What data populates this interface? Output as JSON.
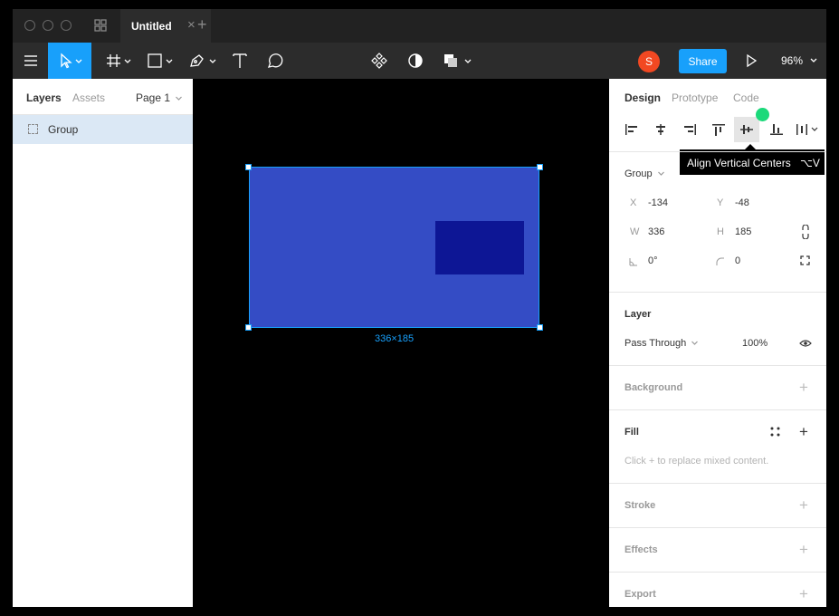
{
  "window": {
    "tab_title": "Untitled",
    "tab_close": "×",
    "tab_add": "+"
  },
  "toolbar": {
    "tools": [
      "menu-icon",
      "move-tool",
      "frame-tool",
      "shape-tool",
      "pen-tool",
      "text-tool",
      "comment-tool",
      "component-icon",
      "mask-icon",
      "boolean-icon"
    ],
    "avatar_initial": "S",
    "share_label": "Share",
    "zoom": "96%",
    "accent": "#18a0fb"
  },
  "left_panel": {
    "tab_layers": "Layers",
    "tab_assets": "Assets",
    "page": "Page 1",
    "layers": [
      {
        "name": "Group",
        "selected": true
      }
    ]
  },
  "canvas": {
    "size_label": "336×185",
    "colors": {
      "frame": "#344cc5",
      "inner": "#0d1695",
      "selection": "#18a0fb"
    }
  },
  "right_panel": {
    "tabs": [
      "Design",
      "Prototype",
      "Code"
    ],
    "tooltip": {
      "text": "Align Vertical Centers",
      "shortcut": "⌥V"
    },
    "group_label": "Group",
    "x_label": "X",
    "x": "-134",
    "y_label": "Y",
    "y": "-48",
    "w_label": "W",
    "w": "336",
    "h_label": "H",
    "h": "185",
    "rotation": "0°",
    "radius": "0",
    "layer": {
      "title": "Layer",
      "blend": "Pass Through",
      "opacity": "100%"
    },
    "background_title": "Background",
    "fill": {
      "title": "Fill",
      "hint": "Click + to replace mixed content."
    },
    "stroke_title": "Stroke",
    "effects_title": "Effects",
    "export_title": "Export"
  }
}
